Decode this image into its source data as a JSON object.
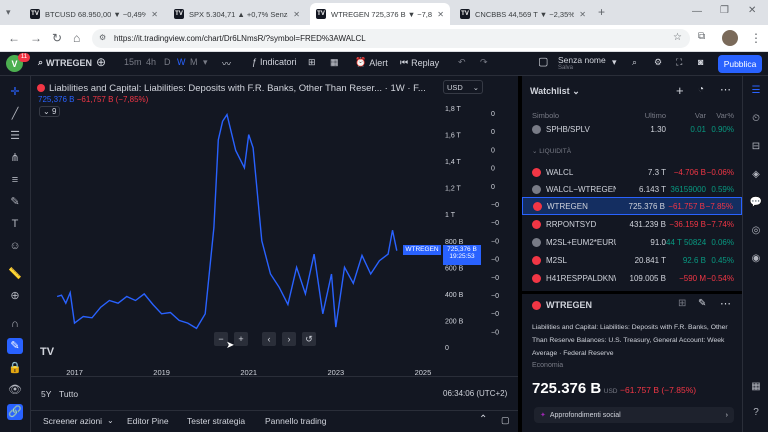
{
  "browser": {
    "tabs": [
      {
        "title": "BTCUSD 68.950,00 ▼ −0,49% Se"
      },
      {
        "title": "SPX 5.304,71 ▲ +0,7% Senza n"
      },
      {
        "title": "WTREGEN 725,376 B ▼ −7,85%"
      },
      {
        "title": "CNCBBS 44,569 T ▼ −2,35% Se"
      }
    ],
    "new_tab": "+",
    "url": "https://it.tradingview.com/chart/Dr6LNmsR/?symbol=FRED%3AWALCL"
  },
  "toolbar": {
    "avatar_letter": "V",
    "badge": "11",
    "symbol": "WTREGEN",
    "intervals": [
      "15m",
      "4h",
      "D",
      "W",
      "M"
    ],
    "active_interval": "W",
    "indicators": "Indicatori",
    "alert": "Alert",
    "replay": "Replay",
    "layout_name": "Senza nome",
    "layout_sub": "Salva",
    "publish": "Pubblica"
  },
  "chart": {
    "title": "Liabilities and Capital: Liabilities: Deposits with F.R. Banks, Other Than Reser... · 1W · F...",
    "ohlc_value": "725,376 B",
    "ohlc_change": "−61,757 B (−7,85%)",
    "indicators_count": "9",
    "currency": "USD",
    "price_labels": [
      "1,8 T",
      "1,6 T",
      "1,4 T",
      "1,2 T",
      "1 T",
      "800 B",
      "600 B",
      "400 B",
      "200 B",
      "0"
    ],
    "right_scale_labels": [
      "0",
      "0",
      "0",
      "0",
      "0",
      "−0",
      "−0",
      "−0",
      "−0",
      "−0",
      "−0",
      "−0",
      "−0"
    ],
    "last_label_symbol": "WTREGEN",
    "last_label_value": "725,376 B",
    "last_label_time": "19:25:53",
    "x_labels": [
      "2017",
      "2019",
      "2021",
      "2023",
      "2025"
    ],
    "line_color": "#2962ff",
    "logo": "TV"
  },
  "chart_data": {
    "type": "line",
    "title": "Liabilities and Capital: Liabilities: Deposits with F.R. Banks, Other Than Reser...",
    "xlabel": "",
    "ylabel": "",
    "ylim": [
      0,
      1800
    ],
    "x": [
      2016.6,
      2016.7,
      2016.8,
      2016.9,
      2017.0,
      2017.2,
      2017.4,
      2017.6,
      2017.8,
      2018.0,
      2018.2,
      2018.4,
      2018.6,
      2018.8,
      2019.0,
      2019.2,
      2019.4,
      2019.6,
      2019.8,
      2020.0,
      2020.2,
      2020.3,
      2020.4,
      2020.5,
      2020.7,
      2020.9,
      2021.0,
      2021.1,
      2021.3,
      2021.5,
      2021.7,
      2021.9,
      2022.1,
      2022.3,
      2022.5,
      2022.7,
      2022.9,
      2023.0,
      2023.2,
      2023.4,
      2023.6,
      2023.8,
      2024.0,
      2024.2,
      2024.3,
      2024.4
    ],
    "values": [
      380,
      390,
      330,
      410,
      180,
      230,
      220,
      300,
      350,
      330,
      380,
      350,
      400,
      320,
      250,
      260,
      200,
      180,
      140,
      250,
      900,
      1560,
      1700,
      1750,
      1480,
      1350,
      1600,
      1500,
      800,
      550,
      450,
      320,
      600,
      400,
      700,
      250,
      550,
      150,
      600,
      480,
      690,
      550,
      650,
      700,
      880,
      725
    ],
    "units": "USD (billions)"
  },
  "bottom": {
    "range": "5Y",
    "range_all": "Tutto",
    "clock": "06:34:06 (UTC+2)",
    "panels": [
      "Screener azioni",
      "Editor Pine",
      "Tester strategia",
      "Pannello trading"
    ]
  },
  "watchlist": {
    "title": "Watchlist",
    "columns": [
      "Simbolo",
      "Ultimo",
      "Var",
      "Var%"
    ],
    "section": "LIQUIDITÀ",
    "rows": [
      {
        "symbol": "SPHB/SPLV",
        "last": "1.30",
        "chg": "0.01",
        "pct": "0.90%",
        "dir": "up",
        "dot": "#787b86"
      },
      {
        "symbol": "WALCL",
        "last": "7.3 T",
        "chg": "−4.706 B",
        "pct": "−0.06%",
        "dir": "down",
        "dot": "#f23645"
      },
      {
        "symbol": "WALCL−WTREGEN−R",
        "last": "6.143 T",
        "chg": "36159000",
        "pct": "0.59%",
        "dir": "up",
        "dot": "#787b86"
      },
      {
        "symbol": "WTREGEN",
        "last": "725.376 B",
        "chg": "−61.757 B",
        "pct": "−7.85%",
        "dir": "down",
        "dot": "#f23645"
      },
      {
        "symbol": "RRPONTSYD",
        "last": "431.239 B",
        "chg": "−36.159 B",
        "pct": "−7.74%",
        "dir": "down",
        "dot": "#f23645"
      },
      {
        "symbol": "M2SL+EUM2*EURUSI",
        "last": "91.0",
        "chg": "44 T 50824593",
        "pct": "0.06%",
        "dir": "up",
        "dot": "#787b86"
      },
      {
        "symbol": "M2SL",
        "last": "20.841 T",
        "chg": "92.6 B",
        "pct": "0.45%",
        "dir": "up",
        "dot": "#f23645"
      },
      {
        "symbol": "H41RESPPALDKNW",
        "last": "109.005 B",
        "chg": "−590 M",
        "pct": "−0.54%",
        "dir": "down",
        "dot": "#f23645"
      }
    ]
  },
  "details": {
    "symbol": "WTREGEN",
    "description": "Liabilities and Capital: Liabilities: Deposits with F.R. Banks, Other Than Reserve Balances: U.S. Treasury, General Account: Week Average",
    "source": "Federal Reserve",
    "category": "Economia",
    "price": "725.376 B",
    "currency": "USD",
    "change": "−61.757 B (−7.85%)",
    "social": "Approfondimenti social"
  }
}
